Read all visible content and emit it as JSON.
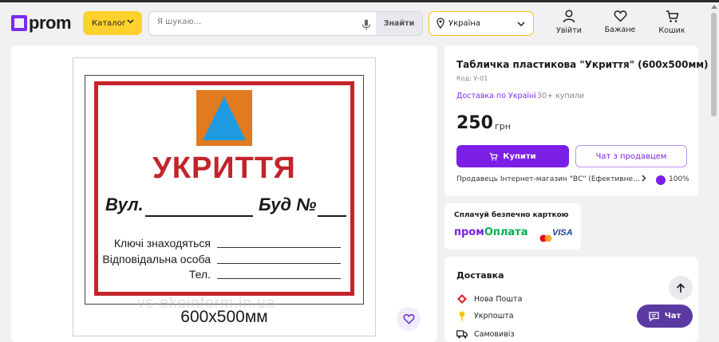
{
  "header": {
    "logo_text": "prom",
    "catalog_label": "Каталог",
    "search_placeholder": "Я шукаю...",
    "search_button": "Знайти",
    "region": "Україна",
    "login_label": "Увійти",
    "wishlist_label": "Бажане",
    "cart_label": "Кошик"
  },
  "product": {
    "title": "Табличка пластикова \"Укриття\" (600х500мм)",
    "code": "Код: У-01",
    "delivery_note": "Доставка по Україні",
    "bought": "30+ купили",
    "price": "250",
    "currency": "грн",
    "buy_label": "Купити",
    "chat_seller_label": "Чат з продавцем",
    "seller": "Продавець Інтернет-магазин \"ВС\" (Ефективне ін...",
    "rating": "100%"
  },
  "sign_image": {
    "title": "УКРИТТЯ",
    "street": "Вул.",
    "house": "Буд №",
    "line1": "Ключі знаходяться",
    "line2": "Відповідальна особа",
    "line3": "Тел.",
    "size": "600х500мм",
    "watermark": "vs-ekoinform.in.ua"
  },
  "payment": {
    "title": "Сплачуй безпечно карткою",
    "prom": "пром",
    "oplata": "Оплата",
    "visa": "VISA"
  },
  "delivery": {
    "title": "Доставка",
    "items": [
      "Нова Пошта",
      "Укрпошта",
      "Самовивіз"
    ]
  },
  "chat_label": "Чат",
  "colors": {
    "brand_purple": "#7b1fe6",
    "catalog_yellow": "#ffd12d",
    "sign_red": "#c3242b",
    "emblem_orange": "#e27a1f",
    "emblem_blue": "#1e9be0"
  }
}
